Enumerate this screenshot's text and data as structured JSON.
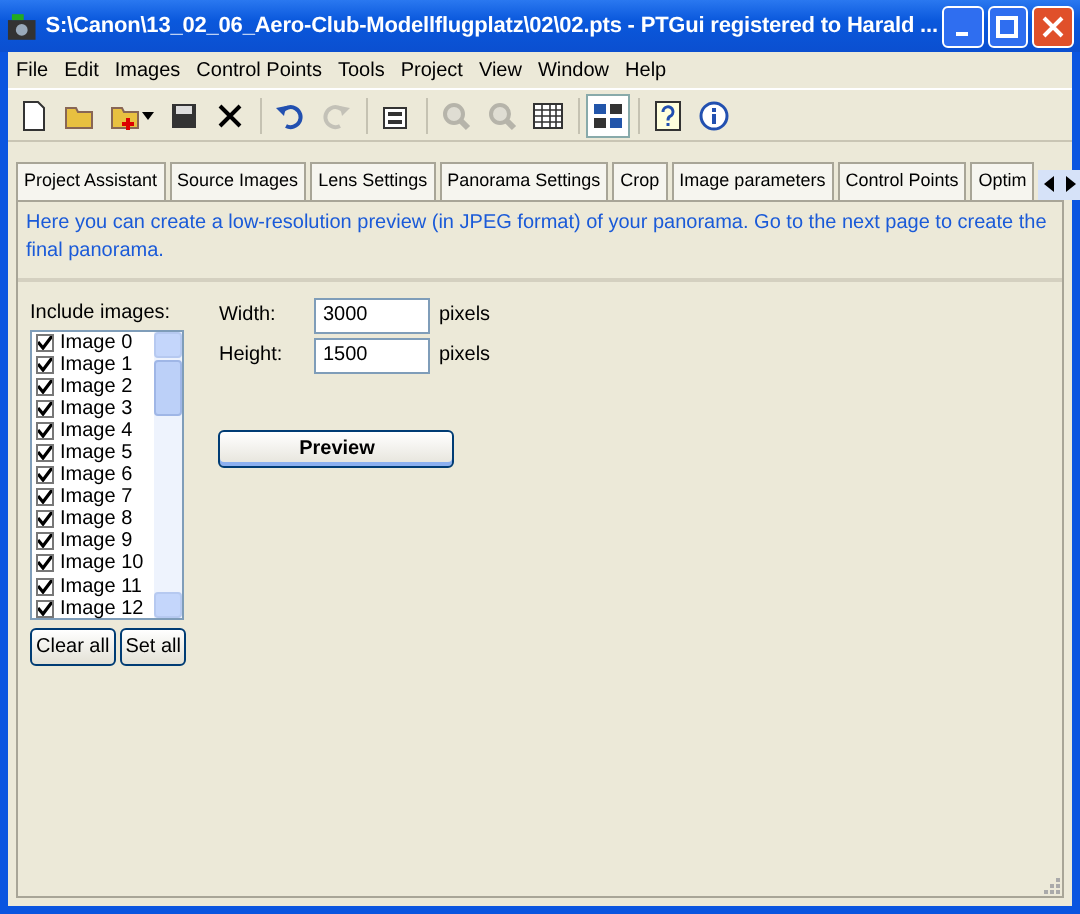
{
  "window": {
    "title": "S:\\Canon\\13_02_06_Aero-Club-Modellflugplatz\\02\\02.pts - PTGui registered to Harald ..."
  },
  "menu": [
    "File",
    "Edit",
    "Images",
    "Control Points",
    "Tools",
    "Project",
    "View",
    "Window",
    "Help"
  ],
  "toolbar": [
    {
      "disabled": false,
      "pressed": false
    },
    {
      "disabled": false,
      "pressed": false
    },
    {
      "disabled": false,
      "pressed": false
    },
    {
      "disabled": false,
      "pressed": false
    },
    {
      "disabled": false,
      "pressed": false
    },
    {
      "disabled": false,
      "pressed": false
    },
    {
      "disabled": true,
      "pressed": false
    },
    {
      "disabled": false,
      "pressed": false
    },
    {
      "disabled": true,
      "pressed": false
    },
    {
      "disabled": true,
      "pressed": false
    },
    {
      "disabled": false,
      "pressed": false
    },
    {
      "disabled": false,
      "pressed": true
    },
    {
      "disabled": false,
      "pressed": false
    },
    {
      "disabled": false,
      "pressed": false
    }
  ],
  "tabs": [
    {
      "label": "Project Assistant",
      "selected": false
    },
    {
      "label": "Source Images",
      "selected": false
    },
    {
      "label": "Lens Settings",
      "selected": false
    },
    {
      "label": "Panorama Settings",
      "selected": false
    },
    {
      "label": "Crop",
      "selected": false
    },
    {
      "label": "Image parameters",
      "selected": false
    },
    {
      "label": "Control Points",
      "selected": false
    },
    {
      "label": "Optim",
      "selected": false
    }
  ],
  "info": "Here you can create a low-resolution preview (in JPEG format) of your panorama. Go to the next  page to create the final panorama.",
  "include_label": "Include images:",
  "images": [
    {
      "label": "Image 0",
      "checked": true
    },
    {
      "label": "Image 1",
      "checked": true
    },
    {
      "label": "Image 2",
      "checked": true
    },
    {
      "label": "Image 3",
      "checked": true
    },
    {
      "label": "Image 4",
      "checked": true
    },
    {
      "label": "Image 5",
      "checked": true
    },
    {
      "label": "Image 6",
      "checked": true
    },
    {
      "label": "Image 7",
      "checked": true
    },
    {
      "label": "Image 8",
      "checked": true
    },
    {
      "label": "Image 9",
      "checked": true
    },
    {
      "label": "Image 10",
      "checked": true
    },
    {
      "label": "Image 11",
      "checked": true
    },
    {
      "label": "Image 12",
      "checked": true
    }
  ],
  "list_buttons": [
    "Clear all",
    "Set all"
  ],
  "fields": [
    {
      "label": "Width:",
      "value": "3000",
      "unit": "pixels"
    },
    {
      "label": "Height:",
      "value": "1500",
      "unit": "pixels"
    }
  ],
  "preview_button": "Preview"
}
